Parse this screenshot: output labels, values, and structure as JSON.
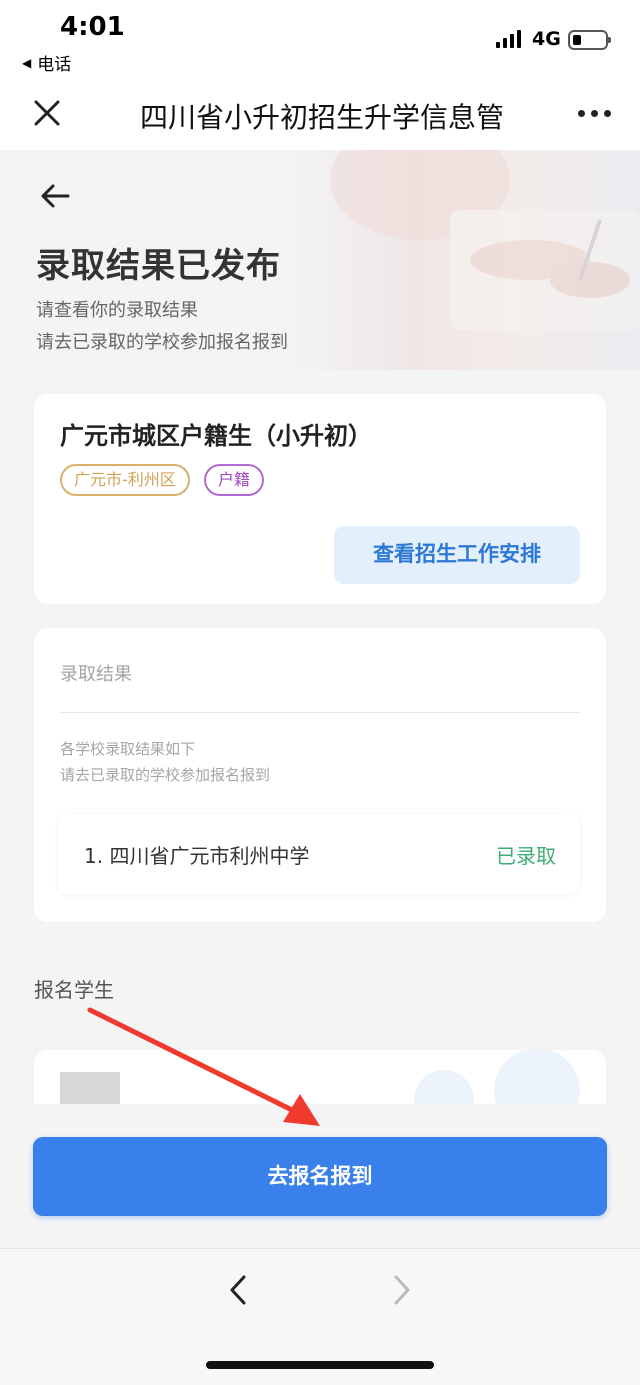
{
  "status_bar": {
    "time": "4:01",
    "back_app": "电话",
    "network": "4G"
  },
  "nav": {
    "title": "四川省小升初招生升学信息管"
  },
  "header": {
    "title": "录取结果已发布",
    "subtitle_lines": [
      "请查看你的录取结果",
      "请去已录取的学校参加报名报到"
    ]
  },
  "enrollment_card": {
    "title": "广元市城区户籍生（小升初）",
    "tags": [
      "广元市-利州区",
      "户籍"
    ],
    "schedule_button": "查看招生工作安排"
  },
  "result_card": {
    "label": "录取结果",
    "hint_lines": [
      "各学校录取结果如下",
      "请去已录取的学校参加报名报到"
    ],
    "schools": [
      {
        "name": "1. 四川省广元市利州中学",
        "status": "已录取"
      }
    ]
  },
  "students": {
    "label": "报名学生"
  },
  "primary_button": "去报名报到",
  "colors": {
    "primary": "#3a80ea",
    "admitted": "#3fad73",
    "region_tag": "#d3a254",
    "huji_tag": "#a24cc4",
    "annotation": "#f03a2e"
  }
}
